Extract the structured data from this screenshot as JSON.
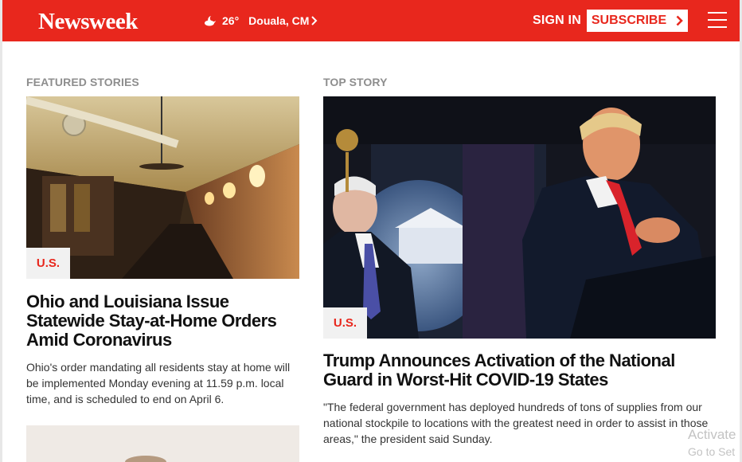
{
  "header": {
    "logo": "Newsweek",
    "weather_icon": "cloud-moon-icon",
    "temperature": "26°",
    "location": "Douala, CM",
    "signin_label": "SIGN IN",
    "subscribe_label": "SUBSCRIBE",
    "brand_color": "#e8271d"
  },
  "featured": {
    "label": "FEATURED STORIES",
    "story": {
      "tag": "U.S.",
      "headline": "Ohio and Louisiana Issue Statewide Stay-at-Home Orders Amid Coronavirus",
      "summary": "Ohio's order mandating all residents stay at home will be implemented Monday evening at 11.59 p.m. local time, and is scheduled to end on April 6."
    }
  },
  "top": {
    "label": "TOP STORY",
    "story": {
      "tag": "U.S.",
      "headline": "Trump Announces Activation of the National Guard in Worst-Hit COVID-19 States",
      "summary": "\"The federal government has deployed hundreds of tons of supplies from our national stockpile to locations with the greatest need in order to assist in those areas,\" the president said Sunday."
    }
  },
  "watermark": {
    "line1": "Activate",
    "line2": "Go to Set"
  }
}
